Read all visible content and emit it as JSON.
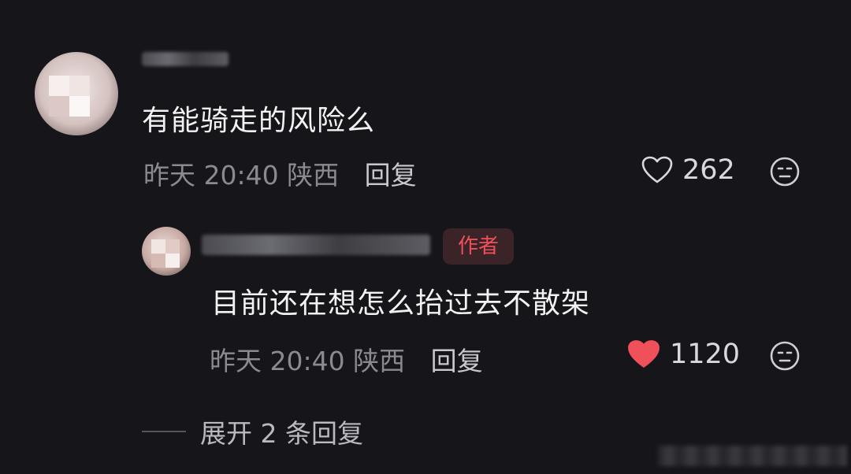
{
  "comment": {
    "text": "有能骑走的风险么",
    "meta": "昨天 20:40 陕西",
    "reply_label": "回复",
    "likes": "262",
    "liked": false
  },
  "reply": {
    "badge": "作者",
    "text": "目前还在想怎么抬过去不散架",
    "meta": "昨天 20:40 陕西",
    "reply_label": "回复",
    "likes": "1120",
    "liked": true
  },
  "expand_label": "展开 2 条回复",
  "colors": {
    "background": "#161519",
    "accent_red": "#f0505a",
    "meta_gray": "#8a8a90"
  },
  "icons": {
    "like": "heart-icon",
    "emoji": "neutral-face-icon"
  }
}
